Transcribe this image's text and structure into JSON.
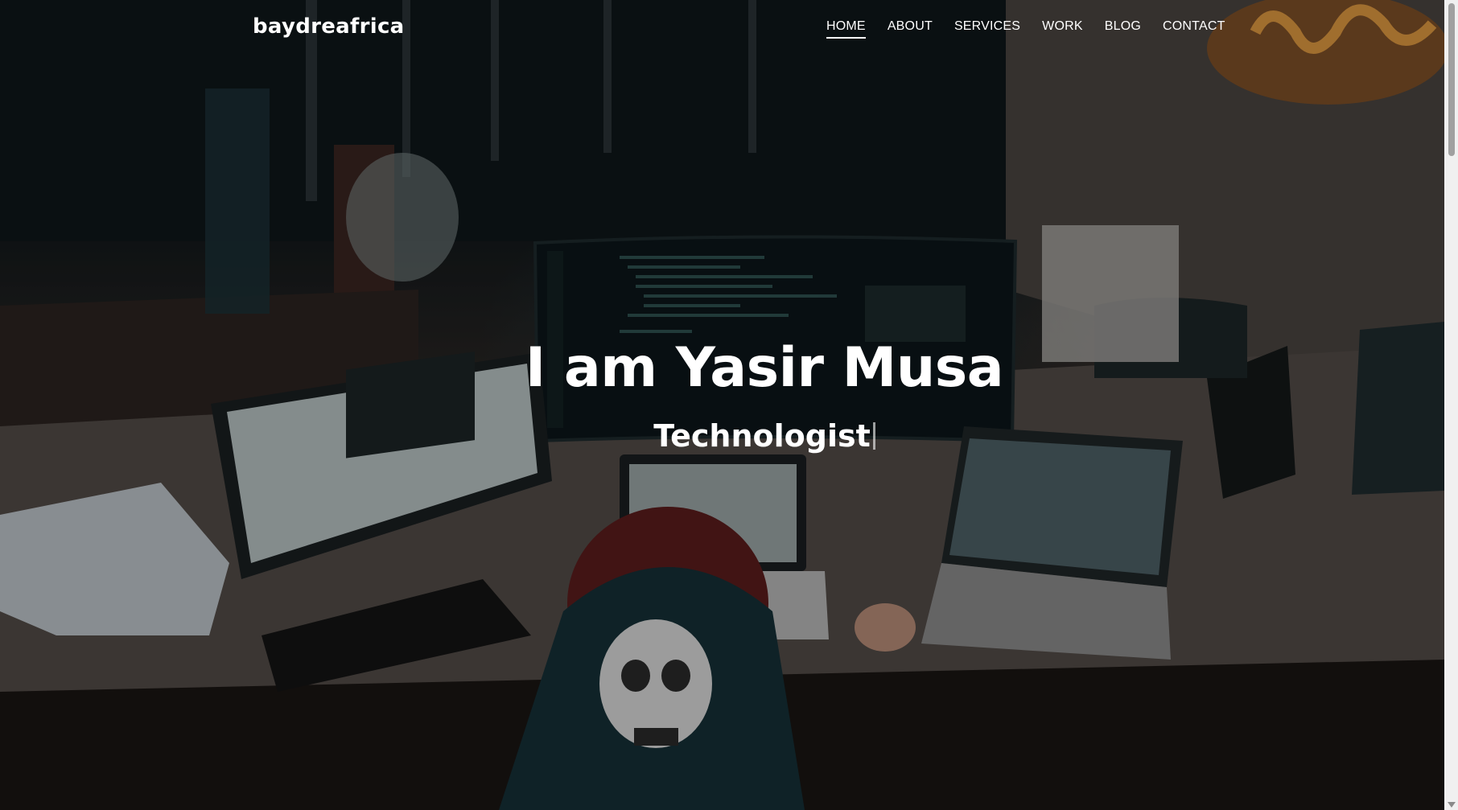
{
  "header": {
    "brand": "baydreafrica",
    "nav": [
      {
        "label": "HOME",
        "active": true
      },
      {
        "label": "ABOUT",
        "active": false
      },
      {
        "label": "SERVICES",
        "active": false
      },
      {
        "label": "WORK",
        "active": false
      },
      {
        "label": "BLOG",
        "active": false
      },
      {
        "label": "CONTACT",
        "active": false
      }
    ]
  },
  "hero": {
    "title": "I am Yasir Musa",
    "subtitle": "Technologist",
    "background_image": "dark office with developer at multiple monitors"
  },
  "colors": {
    "text": "#ffffff",
    "scrollbar_track": "#f0f0f0",
    "scrollbar_thumb": "#a0a0a0"
  }
}
